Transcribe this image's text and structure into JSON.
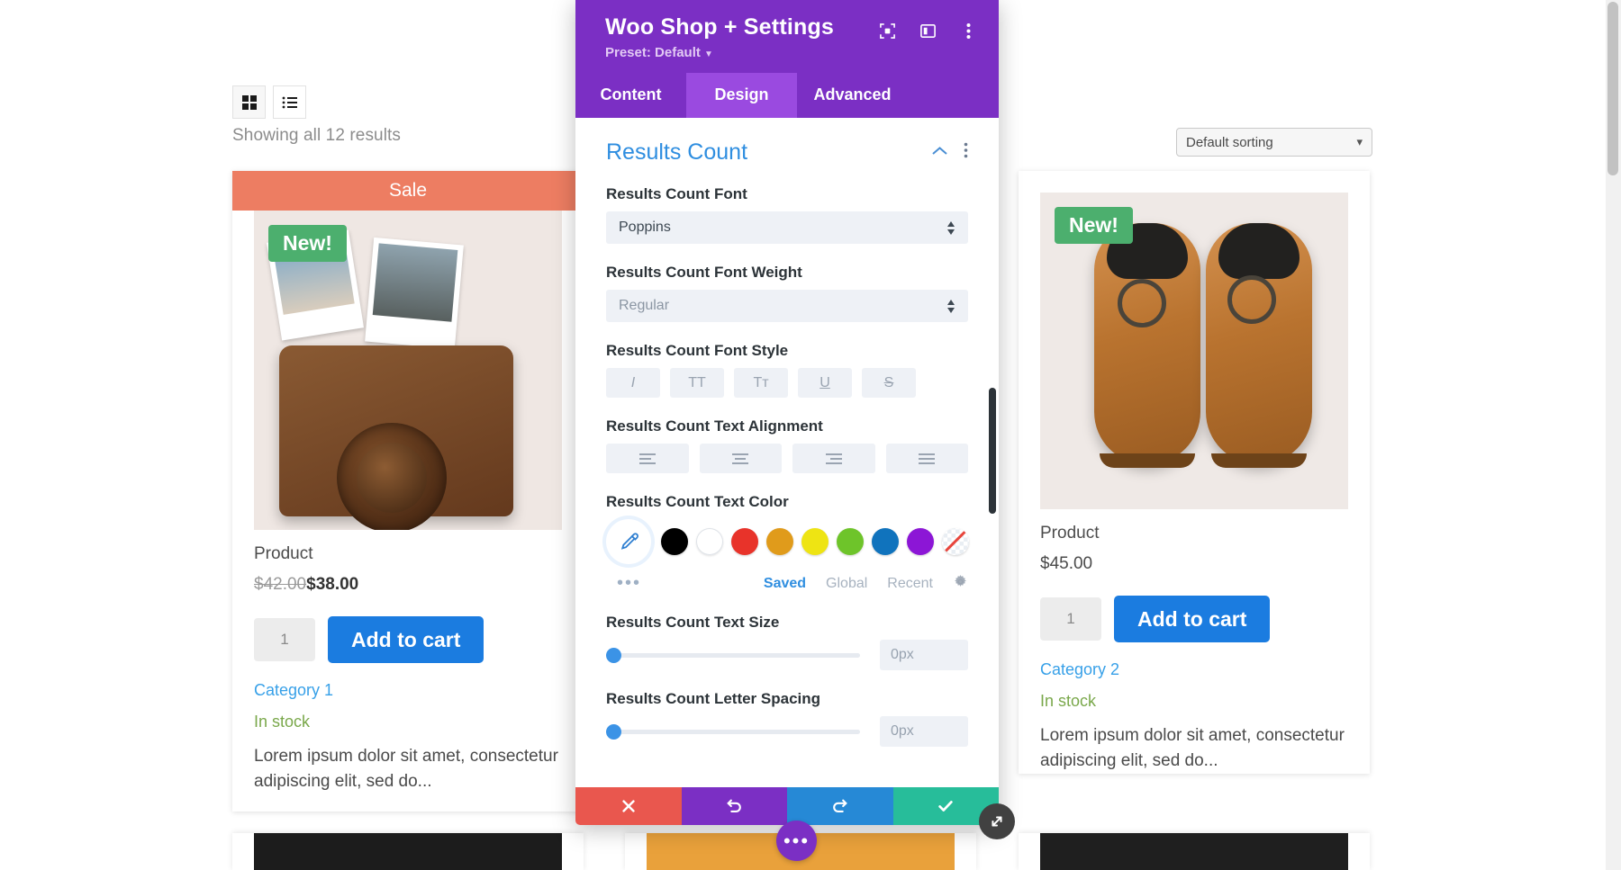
{
  "shop": {
    "view_toggles": [
      {
        "name": "grid-view",
        "icon": "grid-icon",
        "active": true
      },
      {
        "name": "list-view",
        "icon": "list-icon",
        "active": false
      }
    ],
    "results_text": "Showing all 12 results",
    "sorting": {
      "value": "Default sorting",
      "icon": "chevron-down-icon"
    },
    "products": [
      {
        "sale_label": "Sale",
        "badge": "New!",
        "title": "Product",
        "old_price": "$42.00",
        "price": "$38.00",
        "qty": "1",
        "add_to_cart": "Add to cart",
        "category": "Category 1",
        "stock": "In stock",
        "description": "Lorem ipsum dolor sit amet, consectetur adipiscing elit, sed do..."
      },
      {
        "badge": "New!",
        "title": "Product",
        "price": "$45.00",
        "qty": "1",
        "add_to_cart": "Add to cart",
        "category": "Category 2",
        "stock": "In stock",
        "description": "Lorem ipsum dolor sit amet, consectetur adipiscing elit, sed do..."
      }
    ]
  },
  "modal": {
    "title": "Woo Shop + Settings",
    "preset": "Preset: Default",
    "header_icons": [
      "focus-target-icon",
      "layout-panel-icon",
      "vertical-dots-icon"
    ],
    "tabs": [
      {
        "label": "Content",
        "active": false
      },
      {
        "label": "Design",
        "active": true
      },
      {
        "label": "Advanced",
        "active": false
      }
    ],
    "section": {
      "title": "Results Count",
      "collapse_icon": "chevron-up-icon",
      "more_icon": "vertical-dots-icon"
    },
    "fields": {
      "font": {
        "label": "Results Count Font",
        "value": "Poppins"
      },
      "font_weight": {
        "label": "Results Count Font Weight",
        "value": "Regular"
      },
      "font_style": {
        "label": "Results Count Font Style",
        "options": [
          {
            "glyph": "I",
            "name": "italic"
          },
          {
            "glyph": "TT",
            "name": "uppercase"
          },
          {
            "glyph": "Tт",
            "name": "small-caps"
          },
          {
            "glyph": "U",
            "name": "underline"
          },
          {
            "glyph": "S",
            "name": "strikethrough"
          }
        ]
      },
      "text_alignment": {
        "label": "Results Count Text Alignment",
        "options": [
          "align-left",
          "align-center",
          "align-right",
          "align-justify"
        ]
      },
      "text_color": {
        "label": "Results Count Text Color",
        "eyedropper_icon": "eyedropper-icon",
        "swatches": [
          "#000000",
          "#ffffff",
          "#e8332a",
          "#e09b1b",
          "#eee413",
          "#6ec42a",
          "#1073bd",
          "#8c16d6",
          "none"
        ],
        "more_icon": "ellipsis-icon",
        "tabs": [
          {
            "label": "Saved",
            "active": true
          },
          {
            "label": "Global",
            "active": false
          },
          {
            "label": "Recent",
            "active": false
          }
        ],
        "settings_icon": "gear-icon"
      },
      "text_size": {
        "label": "Results Count Text Size",
        "value": "0px",
        "slider_pct": 0
      },
      "letter_spacing": {
        "label": "Results Count Letter Spacing",
        "value": "0px",
        "slider_pct": 0
      }
    },
    "actions": [
      {
        "name": "discard",
        "icon": "x-icon",
        "color": "#e9574e"
      },
      {
        "name": "undo",
        "icon": "undo-icon",
        "color": "#7b2fc4"
      },
      {
        "name": "redo",
        "icon": "redo-icon",
        "color": "#2689d6"
      },
      {
        "name": "save",
        "icon": "check-icon",
        "color": "#27bd9a"
      }
    ],
    "fab": {
      "icon": "ellipsis-icon"
    },
    "resize": {
      "icon": "resize-diagonal-icon"
    }
  }
}
